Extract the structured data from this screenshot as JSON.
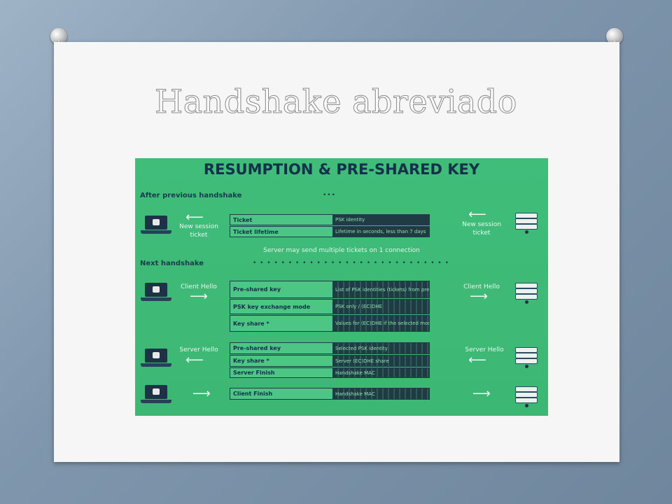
{
  "slide": {
    "title": "Handshake abreviado"
  },
  "diagram": {
    "heading": "RESUMPTION & PRE-SHARED KEY",
    "after_label": "After previous handshake",
    "after_dots": "•••",
    "next_label": "Next handshake",
    "next_dots": "• • • • • • • • • • • • • • • • • • • • • • • • • • • •",
    "note": "Server may send multiple tickets on 1 connection",
    "flows": {
      "new_ticket_left": "New session\nticket",
      "new_ticket_right": "New session\nticket",
      "client_hello_left": "Client Hello",
      "client_hello_right": "Client Hello",
      "server_hello_left": "Server Hello",
      "server_hello_right": "Server Hello"
    },
    "ticket_rows": [
      {
        "key": "Ticket",
        "value": "PSK identity"
      },
      {
        "key": "Ticket lifetime",
        "value": "Lifetime in seconds, less than 7 days"
      }
    ],
    "client_rows": [
      {
        "key": "Pre-shared key",
        "value": "List of PSK identities (tickets) from previous connections"
      },
      {
        "key": "PSK key exchange mode",
        "value": "PSK only / (EC)DHE"
      },
      {
        "key": "Key share *",
        "value": "Values for (EC)DHE if the selected mode allows it"
      }
    ],
    "server_rows": [
      {
        "key": "Pre-shared key",
        "value": "Selected PSK identity"
      },
      {
        "key": "Key share *",
        "value": "Server (EC)DHE share"
      },
      {
        "key": "Server Finish",
        "value": "Handshake MAC"
      }
    ],
    "final_rows": [
      {
        "key": "Client Finish",
        "value": "Handshake MAC"
      }
    ]
  }
}
